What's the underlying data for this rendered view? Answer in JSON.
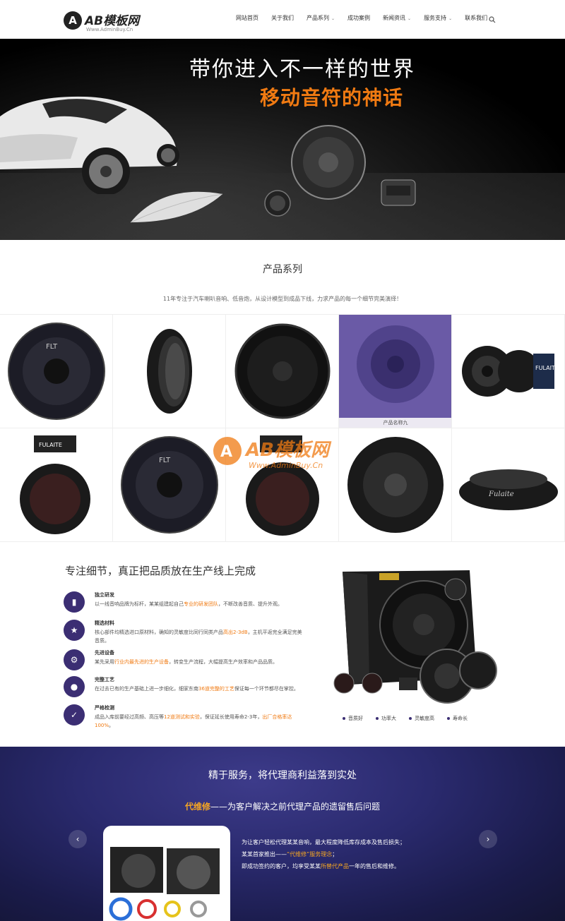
{
  "header": {
    "logo_text": "AB模板网",
    "logo_mark": "A",
    "logo_sub": "Www.AdminBuy.Cn",
    "nav": [
      {
        "label": "网站首页",
        "has_dropdown": false
      },
      {
        "label": "关于我们",
        "has_dropdown": false
      },
      {
        "label": "产品系列",
        "has_dropdown": true
      },
      {
        "label": "成功案例",
        "has_dropdown": false
      },
      {
        "label": "新闻资讯",
        "has_dropdown": true
      },
      {
        "label": "服务支持",
        "has_dropdown": true
      },
      {
        "label": "联系我们",
        "has_dropdown": false
      }
    ],
    "search_icon": "search-icon"
  },
  "banner": {
    "title": "带你进入不一样的世界",
    "subtitle": "移动音符的神话"
  },
  "products": {
    "title": "产品系列",
    "description": "11年专注于汽车喇叭音响、低音炮，从设计模型到成品下线，力求产品的每一个细节完美演绎！",
    "hover_caption": "产品名称九",
    "watermark_text": "AB模板网",
    "watermark_sub": "Www.AdminBuy.Cn",
    "items": [
      {
        "brand": "FLT"
      },
      {
        "brand": ""
      },
      {
        "brand": "FULAITE"
      },
      {
        "brand": ""
      },
      {
        "brand": "FULAITE"
      },
      {
        "brand": "FULAITE"
      },
      {
        "brand": "FLT"
      },
      {
        "brand": ""
      },
      {
        "brand": ""
      },
      {
        "brand": "Fulaite"
      }
    ]
  },
  "features": {
    "title": "专注细节，真正把品质放在生产线上完成",
    "items": [
      {
        "icon": "inbox-icon",
        "name": "独立研发",
        "text_before": "以一线音响品牌为标杆，某某组建起自己",
        "highlight": "专业的研发团队",
        "text_after": "，不断改善音质、提升外观。"
      },
      {
        "icon": "star-icon",
        "name": "精选材料",
        "text_before": "核心部件均精选进口原材料，确知的灵敏度比同行同类产品",
        "highlight": "高出2-3dB",
        "text_after": "，主机平返完全满足完美音质。"
      },
      {
        "icon": "gears-icon",
        "name": "先进设备",
        "text_before": "某先采用",
        "highlight": "行业内最先进的生产设备",
        "text_after": "，转变生产流程，大幅提高生产效率和产品品质。"
      },
      {
        "icon": "users-icon",
        "name": "完整工艺",
        "text_before": "在过去已有的生产基础上进一步细化，细家东南",
        "highlight": "36道完整的工艺",
        "text_after": "保证每一个环节都尽在掌控。"
      },
      {
        "icon": "check-icon",
        "name": "严格检测",
        "text_before": "成品入库前要经过高频、高压等",
        "highlight": "12道测试和实验",
        "text_after": "，保证延长使用寿命2-3年，",
        "highlight2": "出厂合格率达100%",
        "text_after2": "。"
      }
    ],
    "tags": [
      "音质好",
      "功率大",
      "灵敏度高",
      "寿命长"
    ]
  },
  "service": {
    "title": "精于服务，将代理商利益落到实处",
    "sub_accent": "代维修",
    "sub_rest": "——为客户解决之前代理产品的遗留售后问题",
    "lines": [
      {
        "before": "为让客户轻松代理某某音响，最大程度降低库存成本及售后损失；",
        "gold": "",
        "after": ""
      },
      {
        "before": "某某首家推出——",
        "gold": "“代维修”服务理念",
        "after": "；"
      },
      {
        "before": "即成功签约的客户，均享受某某",
        "gold": "所替代产品",
        "after": "一年的售后和维修。"
      }
    ],
    "prev_icon": "chevron-left-icon",
    "next_icon": "chevron-right-icon"
  }
}
